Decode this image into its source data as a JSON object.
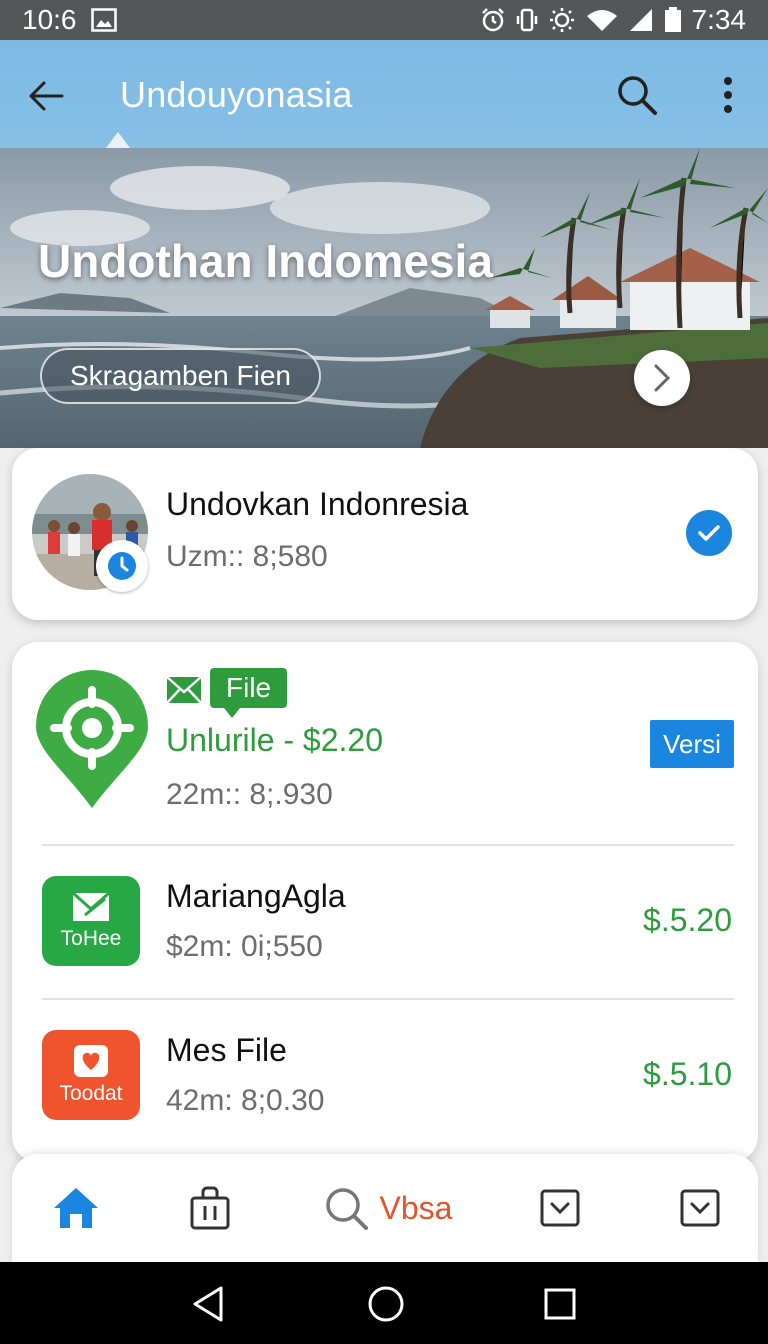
{
  "status_bar": {
    "time_left": "10:6",
    "time_right": "7:34",
    "icons": [
      "image-icon",
      "alarm-icon",
      "vibrate-icon",
      "brightness-icon",
      "wifi-icon",
      "signal-icon",
      "battery-icon"
    ]
  },
  "app_bar": {
    "title": "Undouyonasia",
    "icons": [
      "back-arrow-icon",
      "search-icon",
      "more-vert-icon"
    ]
  },
  "hero": {
    "title": "Undothan Indomesia",
    "chip_label": "Skragamben Fien",
    "next_icon": "chevron-right-icon"
  },
  "profile": {
    "name": "Undovkan Indonresia",
    "subtitle": "Uzm:: 8;580",
    "badge_icon": "clock-icon",
    "status_icon": "check-circle-icon",
    "accent": "#1a86e0"
  },
  "featured": {
    "badge": "File",
    "title": "Unlurile - $2.20",
    "subtitle": "22m:: 8;.930",
    "action": "Versi",
    "icon": "location-pin-icon",
    "accent": "#2e9b3d"
  },
  "list": [
    {
      "title": "MariangAgla",
      "subtitle": "$2m: 0i;550",
      "price": "$.5.20",
      "icon_text": "ToHee",
      "icon": "mail-app-icon",
      "icon_color": "#27a844"
    },
    {
      "title": "Mes File",
      "subtitle": "42m: 8;0.30",
      "price": "$.5.10",
      "icon_text": "Toodat",
      "icon": "heart-app-icon",
      "icon_color": "#f0542f"
    }
  ],
  "bottom_nav": {
    "items": [
      "home-icon",
      "shopping-bag-icon",
      "search-icon",
      "dropdown-box-icon",
      "dropdown-box-icon"
    ],
    "search_label": "Vbsa",
    "active_color": "#1a86e0",
    "label_color": "#e4532a"
  },
  "system_nav": {
    "icons": [
      "back-triangle-icon",
      "home-circle-icon",
      "recents-square-icon"
    ]
  }
}
